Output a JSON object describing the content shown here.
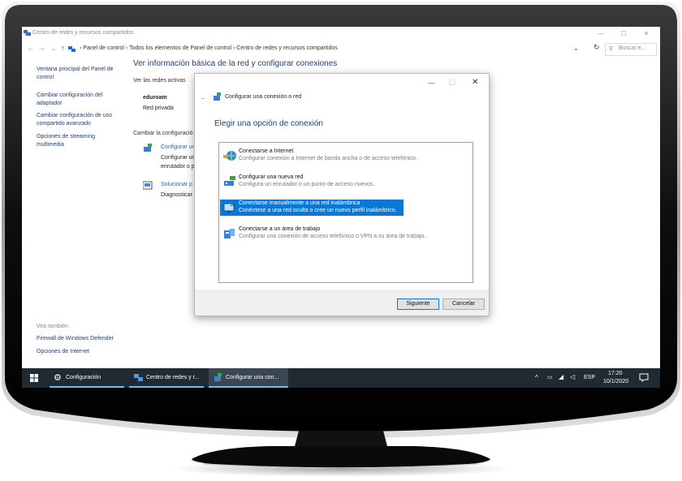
{
  "window": {
    "title": "Centro de redes y recursos compartidos",
    "controls": {
      "minimize": "—",
      "maximize": "☐",
      "close": "✕"
    }
  },
  "address": {
    "crumbs": "Panel de control  ›  Todos los elementos de Panel de control  ›  Centro de redes y recursos compartidos",
    "search_placeholder": "Buscar e..."
  },
  "sidebar": {
    "items": [
      "Ventana principal del Panel de control",
      "Cambiar configuración del adaptador",
      "Cambiar configuración de uso compartido avanzado",
      "Opciones de streaming multimedia"
    ],
    "see_also_label": "Vea también",
    "see_also": [
      "Firewall de Windows Defender",
      "Opciones de Internet"
    ]
  },
  "main": {
    "title": "Ver información básica de la red y configurar conexiones",
    "active_networks_label": "Ver las redes activas",
    "network_name": "eduroam",
    "network_type": "Red privada",
    "change_label": "Cambiar la configuració",
    "configure_link": "Configurar un",
    "configure_desc1": "Configurar un",
    "configure_desc2": "enrutador o p",
    "troubleshoot_link": "Solucionar p",
    "troubleshoot_desc": "Diagnosticar"
  },
  "dialog": {
    "header": "Configurar una conexión o red",
    "heading": "Elegir una opción de conexión",
    "options": [
      {
        "title": "Conectarse a Internet",
        "desc": "Configurar conexión a Internet de banda ancha o de acceso telefónico.",
        "icon": "internet-globe-icon",
        "selected": false
      },
      {
        "title": "Configurar una nueva red",
        "desc": "Configura un enrutador o un punto de acceso nuevos.",
        "icon": "router-icon",
        "selected": false
      },
      {
        "title": "Conectarse manualmente a una red inalámbrica",
        "desc": "Conéctese a una red oculta o cree un nuevo perfil inalámbrico.",
        "icon": "wireless-monitor-icon",
        "selected": true
      },
      {
        "title": "Conectarse a un área de trabajo",
        "desc": "Configurar una conexión de acceso telefónico o VPN a su área de trabajo.",
        "icon": "workplace-phone-icon",
        "selected": false
      }
    ],
    "next_button": "Siguiente",
    "cancel_button": "Cancelar"
  },
  "taskbar": {
    "items": [
      "Configuración",
      "Centro de redes y r...",
      "Configurar una con..."
    ],
    "language": "ESP",
    "time": "17:20",
    "date": "10/1/2020"
  },
  "colors": {
    "accent": "#0b78d7",
    "link": "#1e3f7a",
    "taskbar": "#1f2a33"
  }
}
